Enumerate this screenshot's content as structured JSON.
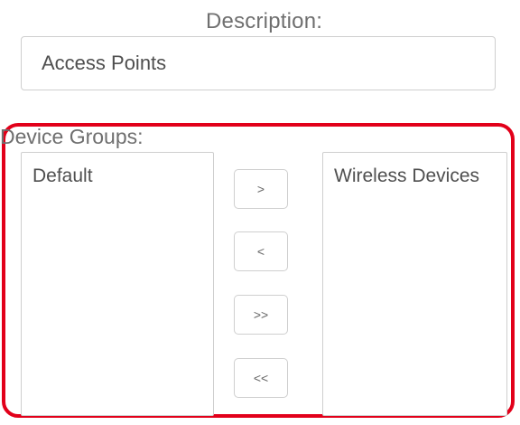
{
  "description": {
    "label": "Description:",
    "value": "Access Points"
  },
  "device_groups": {
    "label": "Device Groups:",
    "available": [
      "Default"
    ],
    "selected": [
      "Wireless Devices"
    ],
    "buttons": {
      "move_right": ">",
      "move_left": "<",
      "move_all_right": ">>",
      "move_all_left": "<<"
    },
    "highlight_color": "#e2001a"
  }
}
